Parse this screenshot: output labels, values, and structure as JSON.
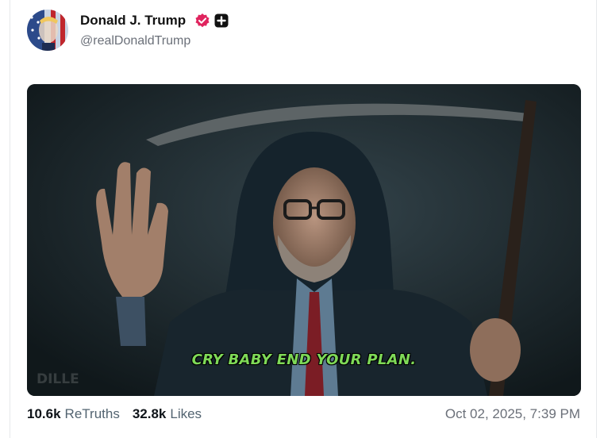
{
  "post": {
    "author_name": "Donald J. Trump",
    "author_handle": "@realDonaldTrump",
    "media": {
      "caption": "CRY BABY END YOUR PLAN.",
      "watermark": "DILLE"
    },
    "retruths_count": "10.6k",
    "retruths_label": "ReTruths",
    "likes_count": "32.8k",
    "likes_label": "Likes",
    "timestamp": "Oct 02, 2025, 7:39 PM"
  },
  "colors": {
    "verified_badge": "#e0245e",
    "caption_text": "#7ed957",
    "muted_text": "#6b7079"
  },
  "icons": {
    "verified": "verified-badge-icon",
    "plus": "plus-square-icon"
  }
}
